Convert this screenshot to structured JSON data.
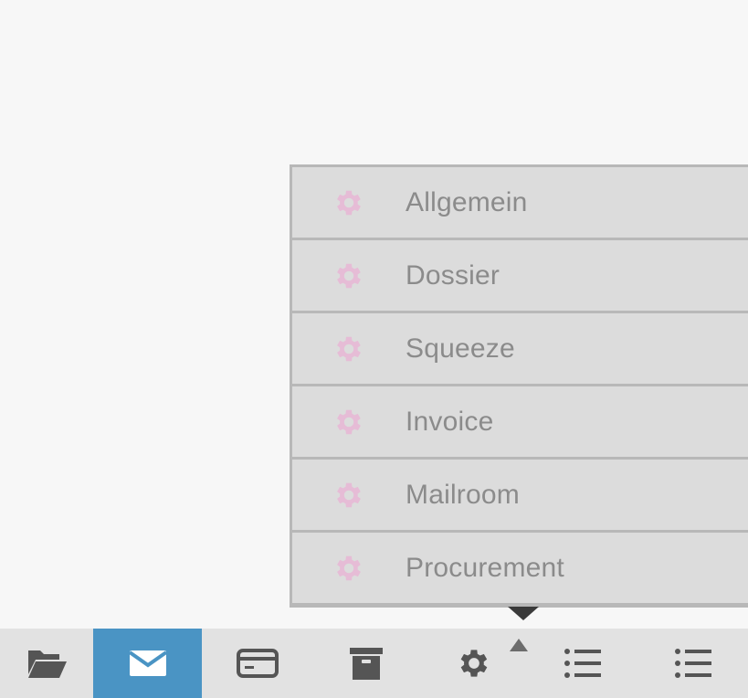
{
  "menu": {
    "items": [
      {
        "label": "Allgemein",
        "icon": "gear-icon"
      },
      {
        "label": "Dossier",
        "icon": "gear-icon"
      },
      {
        "label": "Squeeze",
        "icon": "gear-icon"
      },
      {
        "label": "Invoice",
        "icon": "gear-icon"
      },
      {
        "label": "Mailroom",
        "icon": "gear-icon"
      },
      {
        "label": "Procurement",
        "icon": "gear-icon"
      }
    ],
    "icon_color": "#e6bcd6",
    "text_color": "#8b8b8b",
    "background": "#dcdcdc"
  },
  "toolbar": {
    "buttons": [
      {
        "icon": "folder-open-icon",
        "active": false
      },
      {
        "icon": "envelope-icon",
        "active": true
      },
      {
        "icon": "credit-card-icon",
        "active": false
      },
      {
        "icon": "archive-box-icon",
        "active": false
      },
      {
        "icon": "gear-icon",
        "active": false
      },
      {
        "icon": "list-icon",
        "active": false
      },
      {
        "icon": "list-icon",
        "active": false
      }
    ],
    "active_color": "#4a94c4",
    "icon_color": "#555555"
  }
}
